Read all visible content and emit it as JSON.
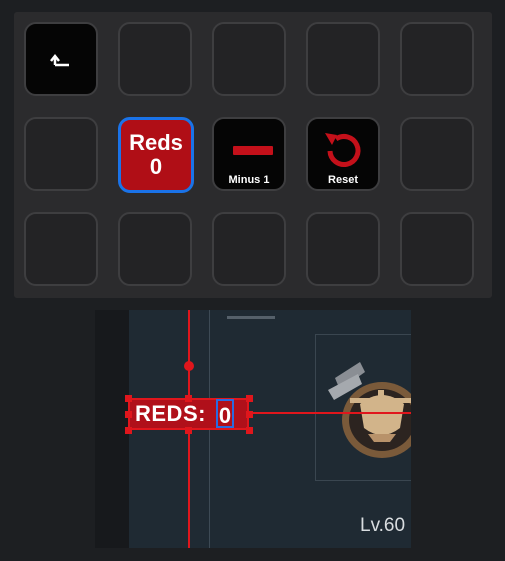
{
  "deck": {
    "back_key": {
      "icon": "return-arrow-icon"
    },
    "reds_key": {
      "title": "Reds",
      "value": "0",
      "bg_color": "#b00e16",
      "selected_color": "#1a73e8"
    },
    "minus_key": {
      "icon": "minus-icon",
      "label": "Minus 1"
    },
    "reset_key": {
      "icon": "reset-icon",
      "label": "Reset"
    }
  },
  "preview": {
    "overlay_label": "REDS:",
    "overlay_value": "0",
    "level_text": "Lv.60",
    "accent_color": "#e0161c"
  }
}
